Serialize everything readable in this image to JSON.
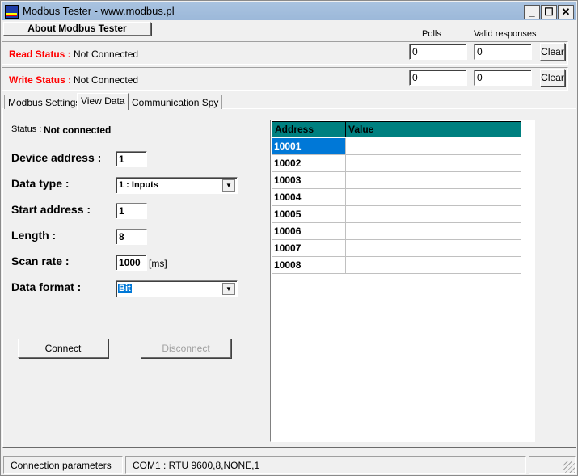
{
  "window": {
    "title": "Modbus Tester - www.modbus.pl",
    "min": "_",
    "max": "☐",
    "close": "✕"
  },
  "about_button": "About Modbus Tester",
  "counters": {
    "polls_label": "Polls",
    "valid_label": "Valid responses"
  },
  "read": {
    "label": "Read Status :",
    "status": "Not Connected",
    "polls": "0",
    "valid": "0",
    "clear": "Clear"
  },
  "write": {
    "label": "Write Status :",
    "status": "Not Connected",
    "polls": "0",
    "valid": "0",
    "clear": "Clear"
  },
  "tabs": [
    {
      "label": "Modbus Settings"
    },
    {
      "label": "View Data",
      "active": true
    },
    {
      "label": "Communication Spy"
    }
  ],
  "view": {
    "status_label": "Status :",
    "status_value": "Not connected",
    "device_address_label": "Device address :",
    "device_address": "1",
    "data_type_label": "Data type :",
    "data_type": "1 : Inputs",
    "start_address_label": "Start address :",
    "start_address": "1",
    "length_label": "Length :",
    "length": "8",
    "scan_rate_label": "Scan rate :",
    "scan_rate": "1000",
    "scan_unit": "[ms]",
    "data_format_label": "Data format :",
    "data_format": "Bit",
    "connect": "Connect",
    "disconnect": "Disconnect"
  },
  "grid": {
    "headers": [
      "Address",
      "Value"
    ],
    "rows": [
      {
        "address": "10001",
        "value": ""
      },
      {
        "address": "10002",
        "value": ""
      },
      {
        "address": "10003",
        "value": ""
      },
      {
        "address": "10004",
        "value": ""
      },
      {
        "address": "10005",
        "value": ""
      },
      {
        "address": "10006",
        "value": ""
      },
      {
        "address": "10007",
        "value": ""
      },
      {
        "address": "10008",
        "value": ""
      }
    ],
    "header_color": "#008080",
    "selected_color": "#0078d7"
  },
  "statusbar": {
    "label": "Connection parameters",
    "params": "COM1 : RTU 9600,8,NONE,1"
  }
}
